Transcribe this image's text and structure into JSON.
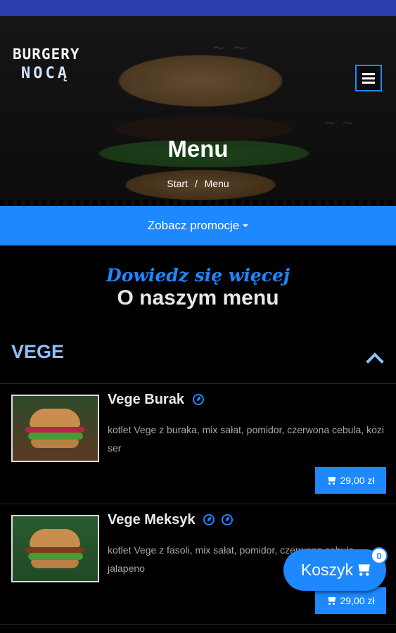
{
  "brand": {
    "line1": "BURGERY",
    "line2": "NOCĄ"
  },
  "hero": {
    "title": "Menu",
    "breadcrumb": [
      "Start",
      "Menu"
    ],
    "separator": "/"
  },
  "promo": {
    "label": "Zobacz promocje"
  },
  "intro": {
    "script": "Dowiedz się więcej",
    "heading": "O naszym menu"
  },
  "category": {
    "name": "VEGE"
  },
  "items": [
    {
      "name": "Vege Burak",
      "description": "kotlet Vege z buraka, mix sałat, pomidor, czerwona cebula, kozi ser",
      "price": "29,00 zł",
      "badge_icons": [
        "leaf-icon"
      ]
    },
    {
      "name": "Vege Meksyk",
      "description": "kotlet Vege z fasoli, mix sałat, pomidor, czerwona cebula, jalapeno",
      "price": "29,00 zł",
      "badge_icons": [
        "chili-icon",
        "leaf-icon"
      ]
    }
  ],
  "cart": {
    "label": "Koszyk",
    "count": "0"
  },
  "colors": {
    "accent": "#1e88ff",
    "status_bar": "#2b3cab",
    "category_text": "#8fc0ff"
  }
}
